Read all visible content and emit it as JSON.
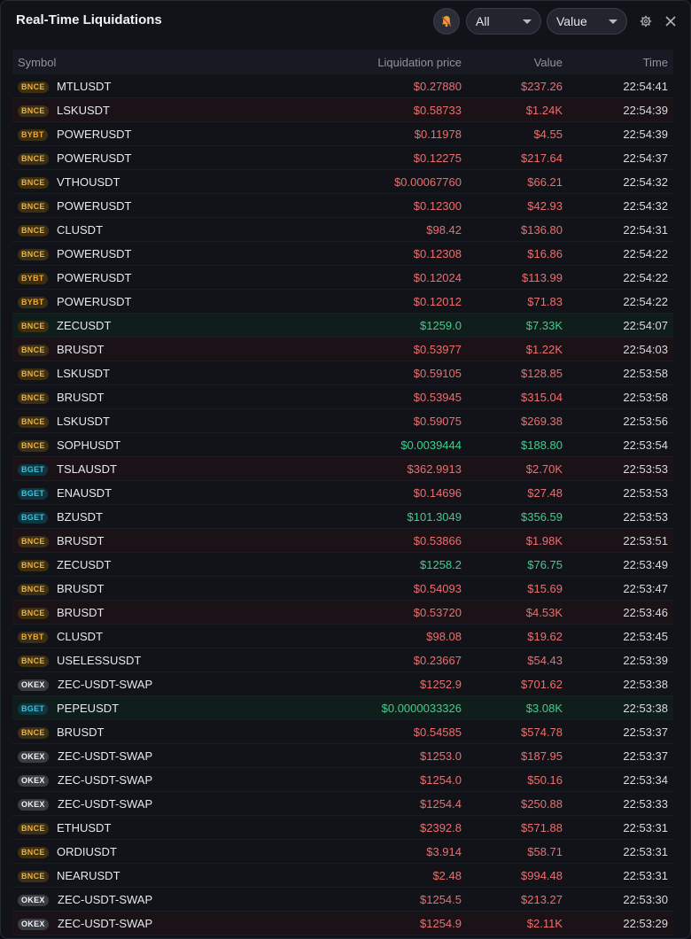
{
  "header": {
    "title": "Real-Time Liquidations",
    "filter_exchange": "All",
    "filter_sort": "Value"
  },
  "colors": {
    "short_liq": "#ee6e6e",
    "long_liq": "#3fcf8e",
    "bnce": "#e9b341",
    "bget": "#33c7dd"
  },
  "icons": [
    "bell-icon",
    "chevron-down-icon",
    "gear-icon",
    "close-icon"
  ],
  "table": {
    "columns": [
      "Symbol",
      "Liquidation price",
      "Value",
      "Time"
    ],
    "rows": [
      {
        "ex": "BNCE",
        "sym": "MTLUSDT",
        "price": "$0.27880",
        "value": "$237.26",
        "time": "22:54:41",
        "side": "red",
        "tint": ""
      },
      {
        "ex": "BNCE",
        "sym": "LSKUSDT",
        "price": "$0.58733",
        "value": "$1.24K",
        "time": "22:54:39",
        "side": "red",
        "tint": "r"
      },
      {
        "ex": "BYBT",
        "sym": "POWERUSDT",
        "price": "$0.11978",
        "value": "$4.55",
        "time": "22:54:39",
        "side": "red",
        "tint": ""
      },
      {
        "ex": "BNCE",
        "sym": "POWERUSDT",
        "price": "$0.12275",
        "value": "$217.64",
        "time": "22:54:37",
        "side": "red",
        "tint": ""
      },
      {
        "ex": "BNCE",
        "sym": "VTHOUSDT",
        "price": "$0.00067760",
        "value": "$66.21",
        "time": "22:54:32",
        "side": "red",
        "tint": ""
      },
      {
        "ex": "BNCE",
        "sym": "POWERUSDT",
        "price": "$0.12300",
        "value": "$42.93",
        "time": "22:54:32",
        "side": "red",
        "tint": ""
      },
      {
        "ex": "BNCE",
        "sym": "CLUSDT",
        "price": "$98.42",
        "value": "$136.80",
        "time": "22:54:31",
        "side": "red",
        "tint": ""
      },
      {
        "ex": "BNCE",
        "sym": "POWERUSDT",
        "price": "$0.12308",
        "value": "$16.86",
        "time": "22:54:22",
        "side": "red",
        "tint": ""
      },
      {
        "ex": "BYBT",
        "sym": "POWERUSDT",
        "price": "$0.12024",
        "value": "$113.99",
        "time": "22:54:22",
        "side": "red",
        "tint": ""
      },
      {
        "ex": "BYBT",
        "sym": "POWERUSDT",
        "price": "$0.12012",
        "value": "$71.83",
        "time": "22:54:22",
        "side": "red",
        "tint": ""
      },
      {
        "ex": "BNCE",
        "sym": "ZECUSDT",
        "price": "$1259.0",
        "value": "$7.33K",
        "time": "22:54:07",
        "side": "green",
        "tint": "g"
      },
      {
        "ex": "BNCE",
        "sym": "BRUSDT",
        "price": "$0.53977",
        "value": "$1.22K",
        "time": "22:54:03",
        "side": "red",
        "tint": "r"
      },
      {
        "ex": "BNCE",
        "sym": "LSKUSDT",
        "price": "$0.59105",
        "value": "$128.85",
        "time": "22:53:58",
        "side": "red",
        "tint": ""
      },
      {
        "ex": "BNCE",
        "sym": "BRUSDT",
        "price": "$0.53945",
        "value": "$315.04",
        "time": "22:53:58",
        "side": "red",
        "tint": ""
      },
      {
        "ex": "BNCE",
        "sym": "LSKUSDT",
        "price": "$0.59075",
        "value": "$269.38",
        "time": "22:53:56",
        "side": "red",
        "tint": ""
      },
      {
        "ex": "BNCE",
        "sym": "SOPHUSDT",
        "price": "$0.0039444",
        "value": "$188.80",
        "time": "22:53:54",
        "side": "green",
        "tint": ""
      },
      {
        "ex": "BGET",
        "sym": "TSLAUSDT",
        "price": "$362.9913",
        "value": "$2.70K",
        "time": "22:53:53",
        "side": "red",
        "tint": "r"
      },
      {
        "ex": "BGET",
        "sym": "ENAUSDT",
        "price": "$0.14696",
        "value": "$27.48",
        "time": "22:53:53",
        "side": "red",
        "tint": ""
      },
      {
        "ex": "BGET",
        "sym": "BZUSDT",
        "price": "$101.3049",
        "value": "$356.59",
        "time": "22:53:53",
        "side": "green",
        "tint": ""
      },
      {
        "ex": "BNCE",
        "sym": "BRUSDT",
        "price": "$0.53866",
        "value": "$1.98K",
        "time": "22:53:51",
        "side": "red",
        "tint": "r"
      },
      {
        "ex": "BNCE",
        "sym": "ZECUSDT",
        "price": "$1258.2",
        "value": "$76.75",
        "time": "22:53:49",
        "side": "green",
        "tint": ""
      },
      {
        "ex": "BNCE",
        "sym": "BRUSDT",
        "price": "$0.54093",
        "value": "$15.69",
        "time": "22:53:47",
        "side": "red",
        "tint": ""
      },
      {
        "ex": "BNCE",
        "sym": "BRUSDT",
        "price": "$0.53720",
        "value": "$4.53K",
        "time": "22:53:46",
        "side": "red",
        "tint": "r"
      },
      {
        "ex": "BYBT",
        "sym": "CLUSDT",
        "price": "$98.08",
        "value": "$19.62",
        "time": "22:53:45",
        "side": "red",
        "tint": ""
      },
      {
        "ex": "BNCE",
        "sym": "USELESSUSDT",
        "price": "$0.23667",
        "value": "$54.43",
        "time": "22:53:39",
        "side": "red",
        "tint": ""
      },
      {
        "ex": "OKEX",
        "sym": "ZEC-USDT-SWAP",
        "price": "$1252.9",
        "value": "$701.62",
        "time": "22:53:38",
        "side": "red",
        "tint": ""
      },
      {
        "ex": "BGET",
        "sym": "PEPEUSDT",
        "price": "$0.0000033326",
        "value": "$3.08K",
        "time": "22:53:38",
        "side": "green",
        "tint": "g"
      },
      {
        "ex": "BNCE",
        "sym": "BRUSDT",
        "price": "$0.54585",
        "value": "$574.78",
        "time": "22:53:37",
        "side": "red",
        "tint": ""
      },
      {
        "ex": "OKEX",
        "sym": "ZEC-USDT-SWAP",
        "price": "$1253.0",
        "value": "$187.95",
        "time": "22:53:37",
        "side": "red",
        "tint": ""
      },
      {
        "ex": "OKEX",
        "sym": "ZEC-USDT-SWAP",
        "price": "$1254.0",
        "value": "$50.16",
        "time": "22:53:34",
        "side": "red",
        "tint": ""
      },
      {
        "ex": "OKEX",
        "sym": "ZEC-USDT-SWAP",
        "price": "$1254.4",
        "value": "$250.88",
        "time": "22:53:33",
        "side": "red",
        "tint": ""
      },
      {
        "ex": "BNCE",
        "sym": "ETHUSDT",
        "price": "$2392.8",
        "value": "$571.88",
        "time": "22:53:31",
        "side": "red",
        "tint": ""
      },
      {
        "ex": "BNCE",
        "sym": "ORDIUSDT",
        "price": "$3.914",
        "value": "$58.71",
        "time": "22:53:31",
        "side": "red",
        "tint": ""
      },
      {
        "ex": "BNCE",
        "sym": "NEARUSDT",
        "price": "$2.48",
        "value": "$994.48",
        "time": "22:53:31",
        "side": "red",
        "tint": ""
      },
      {
        "ex": "OKEX",
        "sym": "ZEC-USDT-SWAP",
        "price": "$1254.5",
        "value": "$213.27",
        "time": "22:53:30",
        "side": "red",
        "tint": ""
      },
      {
        "ex": "OKEX",
        "sym": "ZEC-USDT-SWAP",
        "price": "$1254.9",
        "value": "$2.11K",
        "time": "22:53:29",
        "side": "red",
        "tint": "r"
      }
    ]
  }
}
